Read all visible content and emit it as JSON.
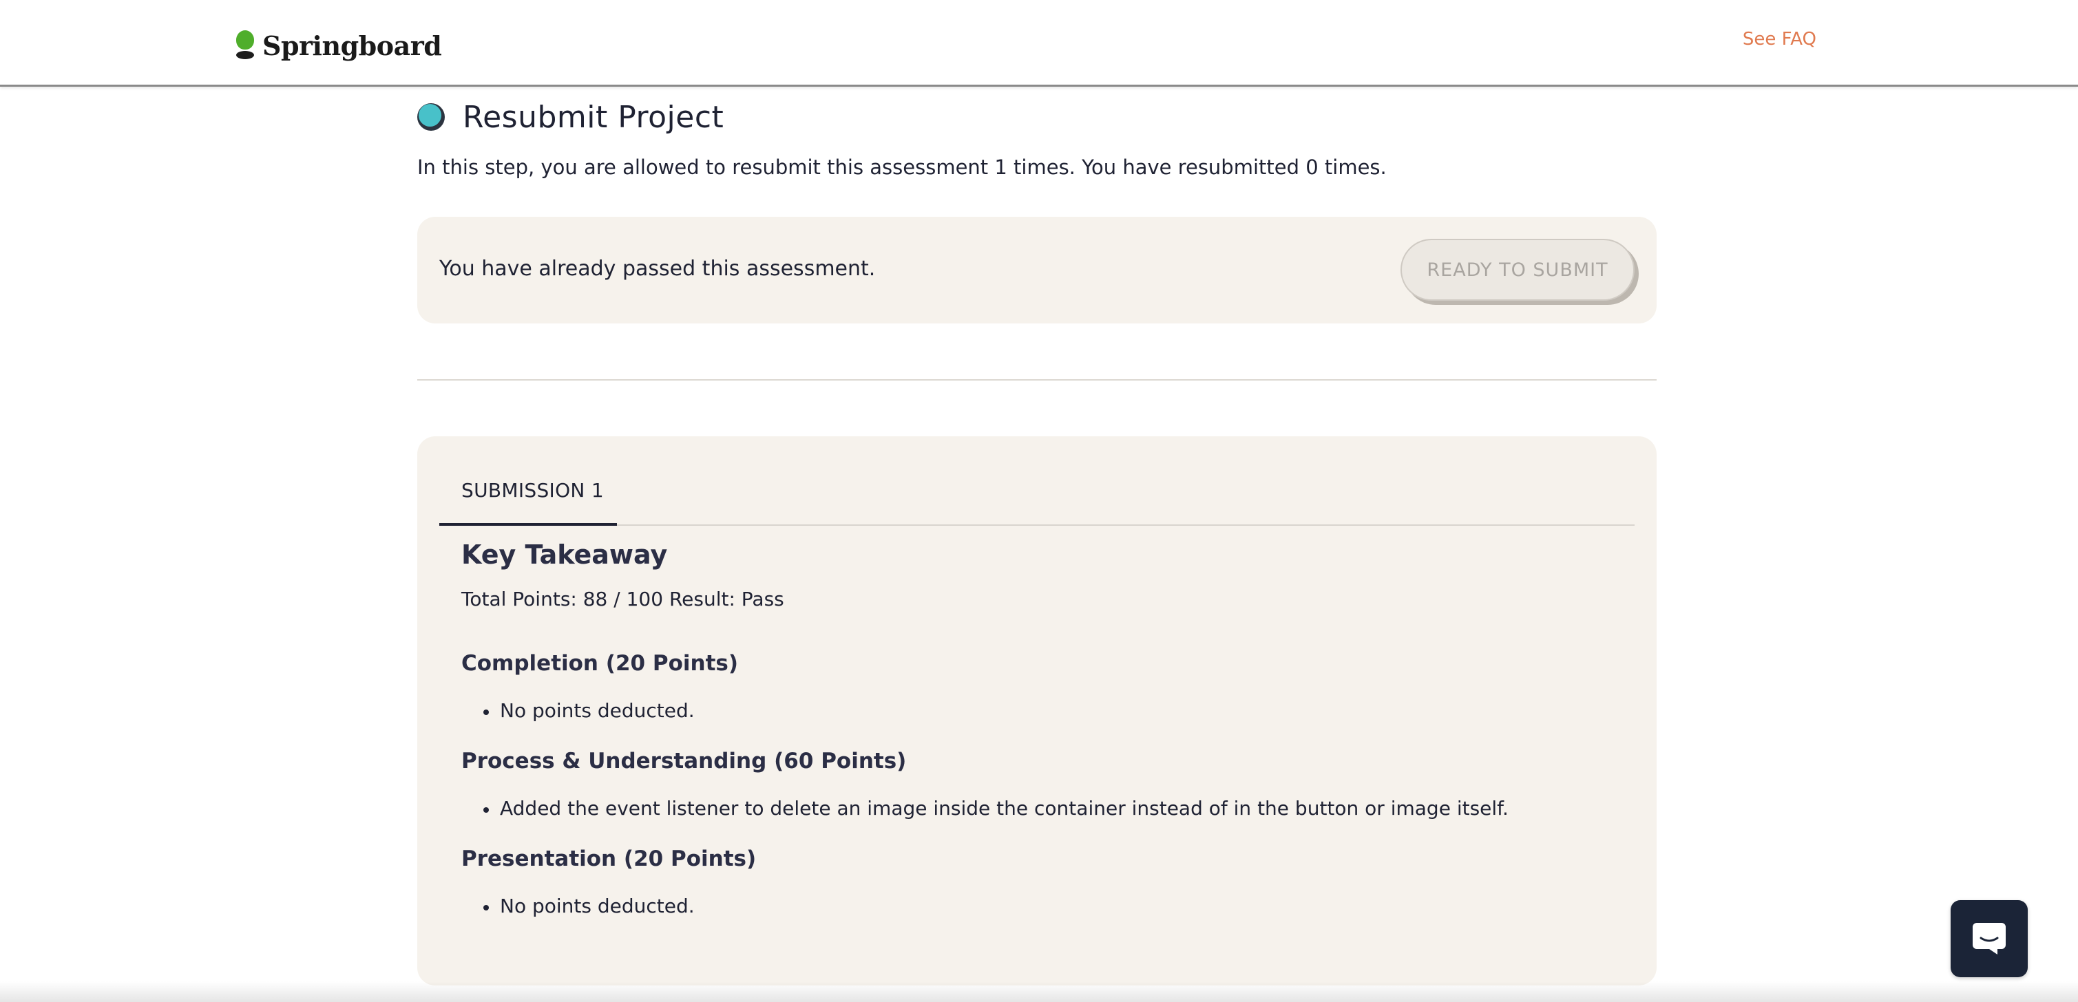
{
  "header": {
    "logo_text": "Springboard",
    "faq_link": "See FAQ"
  },
  "step": {
    "title": "Resubmit Project",
    "intro": "In this step, you are allowed to resubmit this assessment 1 times. You have resubmitted 0 times.",
    "status_message": "You have already passed this assessment.",
    "submit_button": "READY TO SUBMIT"
  },
  "submissions": {
    "tabs": [
      {
        "label": "SUBMISSION 1",
        "active": true
      }
    ],
    "feedback": {
      "heading": "Key Takeaway",
      "summary": "Total Points: 88 / 100 Result: Pass",
      "sections": [
        {
          "title": "Completion (20 Points)",
          "items": [
            "No points deducted."
          ]
        },
        {
          "title": "Process & Understanding (60 Points)",
          "items": [
            "Added the event listener to delete an image inside the container instead of in the button or image itself."
          ]
        },
        {
          "title": "Presentation (20 Points)",
          "items": [
            "No points deducted."
          ]
        }
      ]
    }
  },
  "chat": {
    "icon": "chat-bubble-icon"
  },
  "colors": {
    "accent_orange": "#e07a4f",
    "brand_green": "#4fae2b",
    "status_teal": "#48c1c9",
    "card_bg": "#f6f2ec",
    "navy": "#1b2437"
  }
}
